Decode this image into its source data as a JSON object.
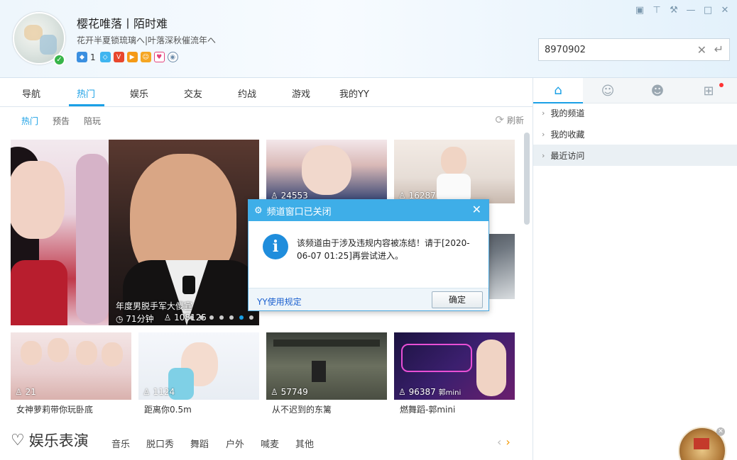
{
  "user": {
    "name": "樱花唯落丨陌时难",
    "signature": "花开半夏锁琉璃へ|叶落深秋催流年へ",
    "badge_count": "1"
  },
  "search": {
    "value": "8970902"
  },
  "main_nav": {
    "tabs": [
      "导航",
      "热门",
      "娱乐",
      "交友",
      "约战",
      "游戏",
      "我的YY"
    ],
    "active": "热门"
  },
  "sub_nav": {
    "tabs": [
      "热门",
      "预告",
      "陪玩"
    ],
    "refresh": "刷新"
  },
  "hero": {
    "title": "年度男脱手军大傻宣",
    "duration": "71分钟",
    "viewers": "108125"
  },
  "tiles_top": [
    {
      "viewers": "24553"
    },
    {
      "viewers": "16287"
    }
  ],
  "tiles_bottom": [
    {
      "viewers": "21",
      "caption": "女神萝莉带你玩卧底"
    },
    {
      "viewers": "1124",
      "caption": "距离你0.5m"
    },
    {
      "viewers": "57749",
      "caption": "从不迟到的东篱"
    },
    {
      "viewers": "96387",
      "caption": "燃舞蹈-郭mini",
      "overlay": "郭mini"
    }
  ],
  "section": {
    "title": "娱乐表演",
    "tabs": [
      "音乐",
      "脱口秀",
      "舞蹈",
      "户外",
      "喊麦",
      "其他"
    ]
  },
  "right_panel": {
    "items": [
      "我的频道",
      "我的收藏",
      "最近访问"
    ]
  },
  "dialog": {
    "title": "频道窗口已关闭",
    "message": "该频道由于涉及违规内容被冻结！请于[2020-06-07 01:25]再尝试进入。",
    "link": "YY使用规定",
    "ok": "确定"
  }
}
